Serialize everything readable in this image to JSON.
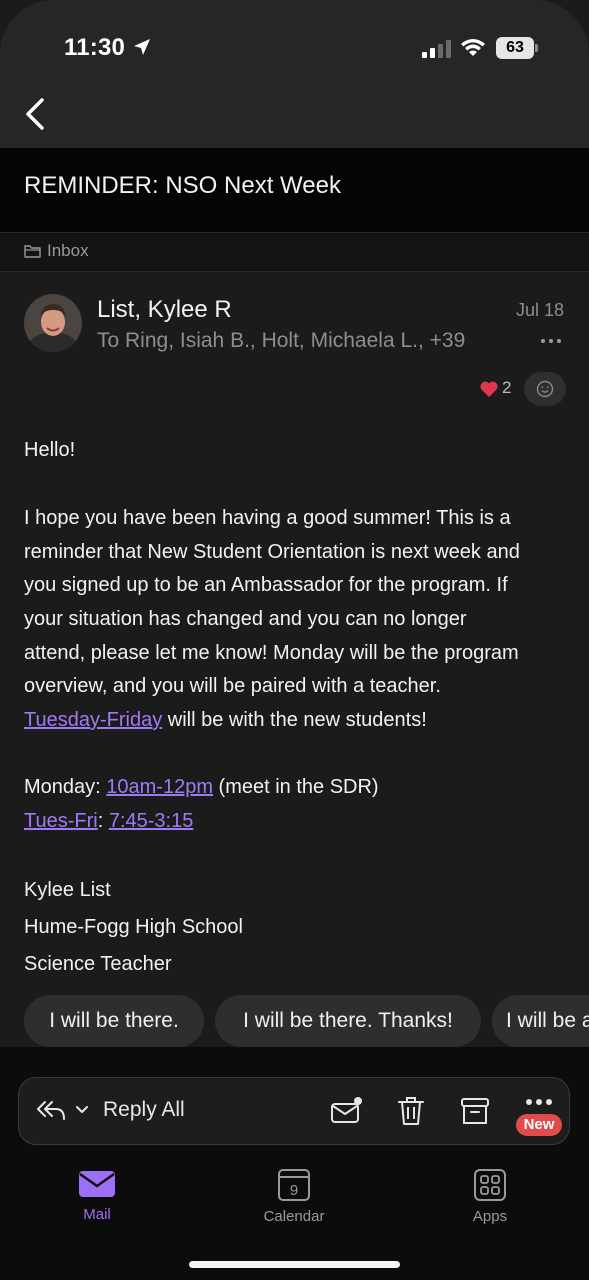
{
  "status_bar": {
    "time": "11:30",
    "battery": "63"
  },
  "header": {
    "subject": "REMINDER: NSO Next Week",
    "folder": "Inbox"
  },
  "message": {
    "sender": "List, Kylee R",
    "recipients": "To Ring, Isiah B., Holt, Michaela L., +39",
    "date": "Jul 18",
    "reaction_count": "2",
    "greeting": "Hello!",
    "para_lines": [
      "I hope you have been having a good summer! This is a",
      "reminder that New Student Orientation is next week and",
      "you signed up to be an Ambassador for the program. If",
      "your situation has changed and you can no longer",
      "attend, please let me know! Monday will be the program",
      "overview, and you will be paired with a teacher."
    ],
    "para_last_link": "Tuesday-Friday",
    "para_last_rest": " will be with the new students!",
    "monday_label": "Monday: ",
    "monday_time": "10am-12pm",
    "monday_rest": " (meet in the SDR)",
    "tues_label": "Tues-Fri",
    "tues_sep": ": ",
    "tues_time": "7:45-3:15",
    "signature": [
      "Kylee List",
      "Hume-Fogg High School",
      "Science Teacher"
    ]
  },
  "quick_replies": [
    "I will be there.",
    "I will be there. Thanks!",
    "I will be a"
  ],
  "action_bar": {
    "reply_label": "Reply All",
    "new_badge": "New"
  },
  "tabs": [
    {
      "label": "Mail",
      "active": true
    },
    {
      "label": "Calendar",
      "day": "9",
      "active": false
    },
    {
      "label": "Apps",
      "active": false
    }
  ],
  "colors": {
    "accent": "#9d6ff5",
    "link": "#a07af6",
    "badge": "#e14b4b",
    "heart": "#e0364f"
  }
}
